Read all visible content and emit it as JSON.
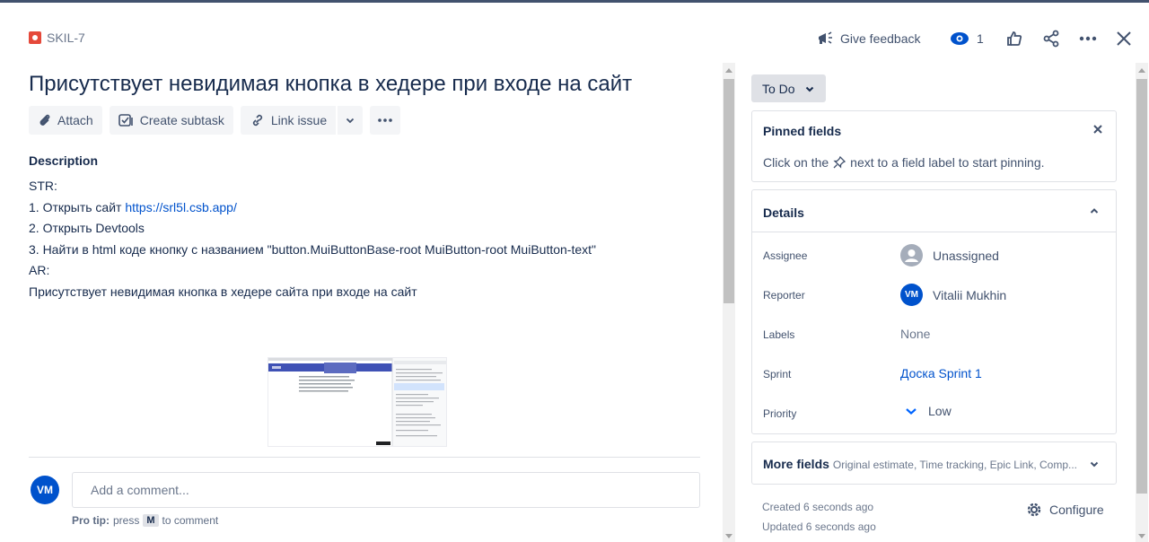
{
  "header": {
    "issue_key": "SKIL-7",
    "give_feedback": "Give feedback",
    "watch_count": "1"
  },
  "issue": {
    "title": "Присутствует невидимая кнопка в хедере при входе на сайт"
  },
  "toolbar": {
    "attach": "Attach",
    "create_subtask": "Create subtask",
    "link_issue": "Link issue"
  },
  "description": {
    "heading": "Description",
    "line1": "STR:",
    "line2_prefix": "1. Открыть сайт ",
    "line2_link": "https://srl5l.csb.app/",
    "line3": "2. Открыть Devtools",
    "line4": "3. Найти в html коде кнопку с названием \"button.MuiButtonBase-root MuiButton-root MuiButton-text\"",
    "line5": "AR:",
    "line6": "Присутствует невидимая кнопка в хедере сайта при входе на сайт"
  },
  "comment": {
    "avatar_initials": "VM",
    "placeholder": "Add a comment...",
    "pro_tip_label": "Pro tip:",
    "pro_tip_press": "press",
    "pro_tip_key": "M",
    "pro_tip_suffix": "to comment"
  },
  "status": {
    "label": "To Do"
  },
  "pinned": {
    "title": "Pinned fields",
    "hint_before": "Click on the",
    "hint_after": "next to a field label to start pinning."
  },
  "details": {
    "title": "Details",
    "assignee_label": "Assignee",
    "assignee_value": "Unassigned",
    "reporter_label": "Reporter",
    "reporter_initials": "VM",
    "reporter_value": "Vitalii Mukhin",
    "labels_label": "Labels",
    "labels_value": "None",
    "sprint_label": "Sprint",
    "sprint_value": "Доска Sprint 1",
    "priority_label": "Priority",
    "priority_value": "Low"
  },
  "more_fields": {
    "title": "More fields",
    "summary": "Original estimate, Time tracking, Epic Link, Comp..."
  },
  "footer": {
    "created": "Created 6 seconds ago",
    "updated": "Updated 6 seconds ago",
    "configure": "Configure"
  },
  "icons": {
    "issue_type": "bug-icon",
    "feedback": "megaphone-icon",
    "watch": "eye-icon",
    "like": "thumbs-up-icon",
    "share": "share-icon",
    "more": "more-icon",
    "close": "close-icon",
    "pin": "pin-icon",
    "gear": "gear-icon"
  },
  "colors": {
    "accent": "#0052CC",
    "bug_red": "#E5493A",
    "text": "#172B4D",
    "subtle": "#42526E"
  }
}
